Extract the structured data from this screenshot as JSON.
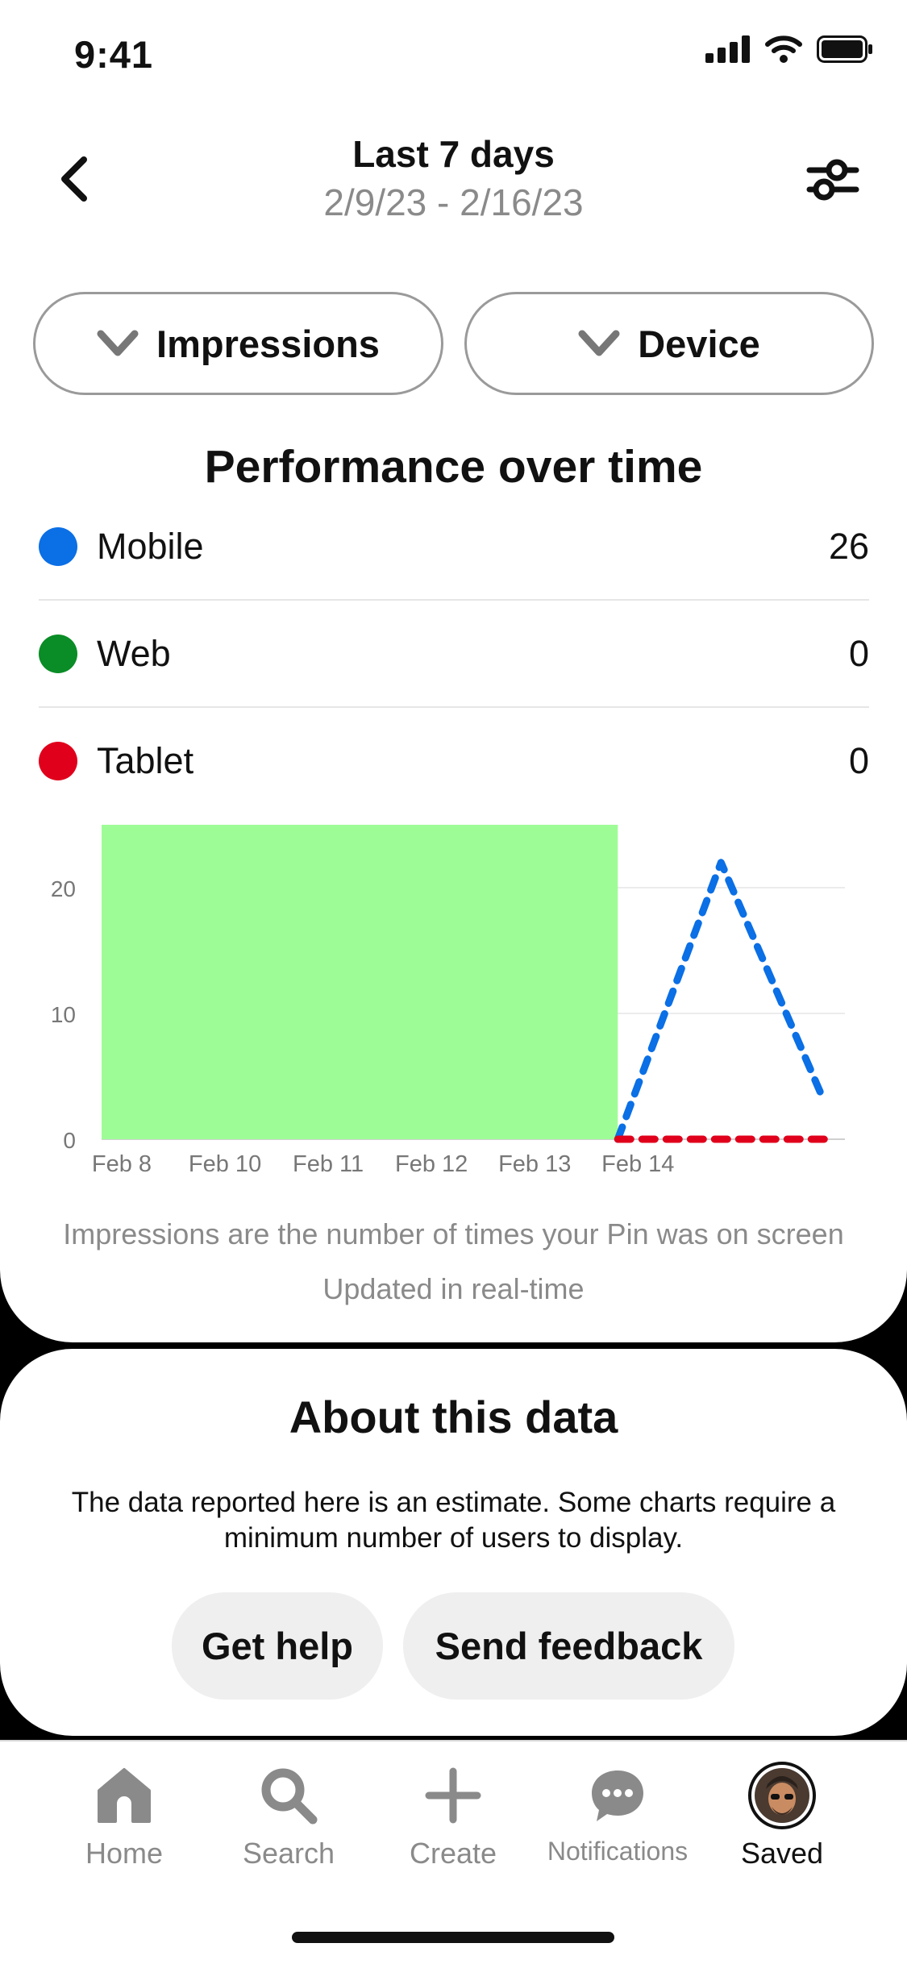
{
  "status_bar": {
    "time": "9:41"
  },
  "header": {
    "title": "Last 7 days",
    "date_range": "2/9/23 - 2/16/23"
  },
  "filters": {
    "metric": "Impressions",
    "breakdown": "Device"
  },
  "section": {
    "title": "Performance over time"
  },
  "legend": [
    {
      "label": "Mobile",
      "value": "26",
      "color": "#0b6fe5"
    },
    {
      "label": "Web",
      "value": "0",
      "color": "#0a8c26"
    },
    {
      "label": "Tablet",
      "value": "0",
      "color": "#e0001b"
    }
  ],
  "chart_data": {
    "type": "line",
    "x": [
      "Feb 8",
      "Feb 10",
      "Feb 11",
      "Feb 12",
      "Feb 13",
      "Feb 14"
    ],
    "yticks": [
      "0",
      "10",
      "20"
    ],
    "ylim": [
      0,
      25
    ],
    "series": [
      {
        "name": "Mobile",
        "color": "#0b6fe5",
        "points": [
          [
            5,
            0
          ],
          [
            6,
            22
          ],
          [
            7,
            3
          ]
        ]
      },
      {
        "name": "Tablet",
        "color": "#e0001b",
        "points": [
          [
            5,
            0
          ],
          [
            7,
            0
          ]
        ]
      }
    ],
    "shaded_region": {
      "from_x": 0,
      "to_x": 5,
      "color": "#9efc96"
    }
  },
  "notes": {
    "impressions": "Impressions are the number of times your Pin was on screen",
    "updated": "Updated in real-time"
  },
  "about": {
    "title": "About this data",
    "text": "The data reported here is an estimate. Some charts require a minimum number of users to display.",
    "help_label": "Get help",
    "feedback_label": "Send feedback"
  },
  "tabs": [
    {
      "label": "Home",
      "icon": "home-icon"
    },
    {
      "label": "Search",
      "icon": "search-icon"
    },
    {
      "label": "Create",
      "icon": "plus-icon"
    },
    {
      "label": "Notifications",
      "icon": "chat-bubble-icon"
    },
    {
      "label": "Saved",
      "icon": "avatar"
    }
  ]
}
